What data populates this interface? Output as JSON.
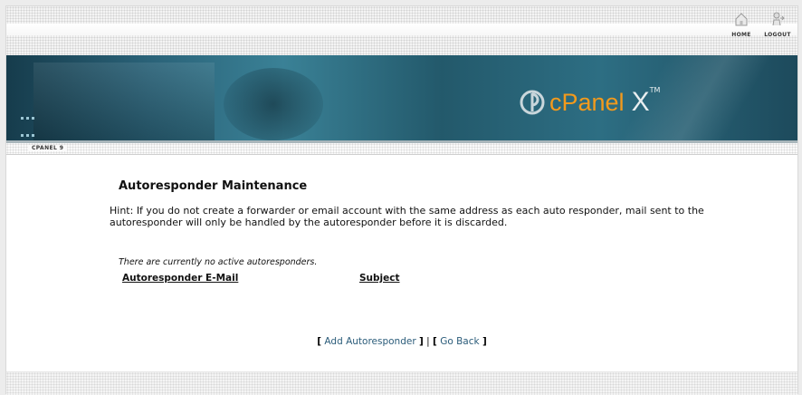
{
  "nav": {
    "home_label": "HOME",
    "logout_label": "LOGOUT"
  },
  "banner": {
    "logo_word": "cPanel",
    "logo_version": "X",
    "logo_tm": "TM"
  },
  "breadcrumb": {
    "label": "CPANEL 9"
  },
  "page": {
    "title": "Autoresponder Maintenance",
    "hint": "Hint: If you do not create a forwarder or email account with the same address as each auto responder, mail sent to the autoresponder will only be handled by the autoresponder before it is discarded.",
    "empty_message": "There are currently no active autoresponders.",
    "columns": [
      "Autoresponder E-Mail",
      "Subject"
    ]
  },
  "actions": {
    "add_label": "Add Autoresponder",
    "back_label": "Go Back",
    "open_bracket": "[",
    "close_bracket": "]",
    "separator": "|"
  },
  "colors": {
    "accent": "#f39a1c",
    "banner": "#2a6278",
    "link": "#2b5c7a"
  }
}
